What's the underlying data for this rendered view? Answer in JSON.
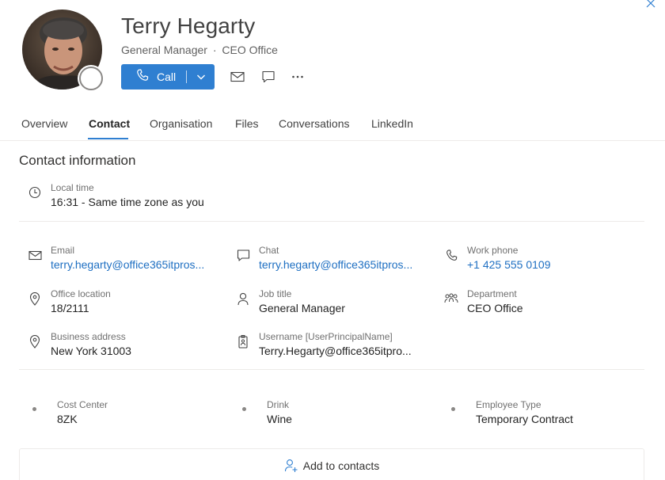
{
  "window": {
    "close_icon": "close-icon"
  },
  "profile": {
    "name": "Terry Hegarty",
    "job_title": "General Manager",
    "separator": "·",
    "department": "CEO Office",
    "presence": "offline"
  },
  "actions": {
    "call_label": "Call",
    "call_icon": "phone-icon",
    "call_dropdown_icon": "chevron-down-icon",
    "mail_icon": "mail-icon",
    "chat_icon": "chat-icon",
    "more_icon": "more-icon",
    "more_label": "···"
  },
  "tabs": [
    {
      "label": "Overview",
      "active": false
    },
    {
      "label": "Contact",
      "active": true
    },
    {
      "label": "Organisation",
      "active": false
    },
    {
      "label": "Files",
      "active": false
    },
    {
      "label": "Conversations",
      "active": false
    },
    {
      "label": "LinkedIn",
      "active": false
    }
  ],
  "contact": {
    "section_title": "Contact information",
    "local_time": {
      "label": "Local time",
      "value": "16:31 - Same time zone as you",
      "icon": "clock-icon"
    },
    "email": {
      "label": "Email",
      "value": "terry.hegarty@office365itpros...",
      "icon": "mail-icon"
    },
    "chat": {
      "label": "Chat",
      "value": "terry.hegarty@office365itpros...",
      "icon": "chat-icon"
    },
    "work_phone": {
      "label": "Work phone",
      "value": "+1 425 555 0109",
      "icon": "phone-icon"
    },
    "office_location": {
      "label": "Office location",
      "value": "18/2111",
      "icon": "location-pin-icon"
    },
    "job_title": {
      "label": "Job title",
      "value": "General Manager",
      "icon": "person-icon"
    },
    "department": {
      "label": "Department",
      "value": "CEO Office",
      "icon": "people-team-icon"
    },
    "business_address": {
      "label": "Business address",
      "value": "New York 31003",
      "icon": "location-pin-icon"
    },
    "username": {
      "label": "Username [UserPrincipalName]",
      "value": "Terry.Hegarty@office365itpro...",
      "icon": "id-badge-icon"
    }
  },
  "custom_attributes": [
    {
      "label": "Cost Center",
      "value": "8ZK"
    },
    {
      "label": "Drink",
      "value": "Wine"
    },
    {
      "label": "Employee Type",
      "value": "Temporary Contract"
    }
  ],
  "add_to_contacts": {
    "label": "Add to contacts",
    "icon": "person-add-icon"
  },
  "colors": {
    "accent": "#2f7fd1",
    "link": "#1e6fc2",
    "divider": "#edebe9"
  }
}
